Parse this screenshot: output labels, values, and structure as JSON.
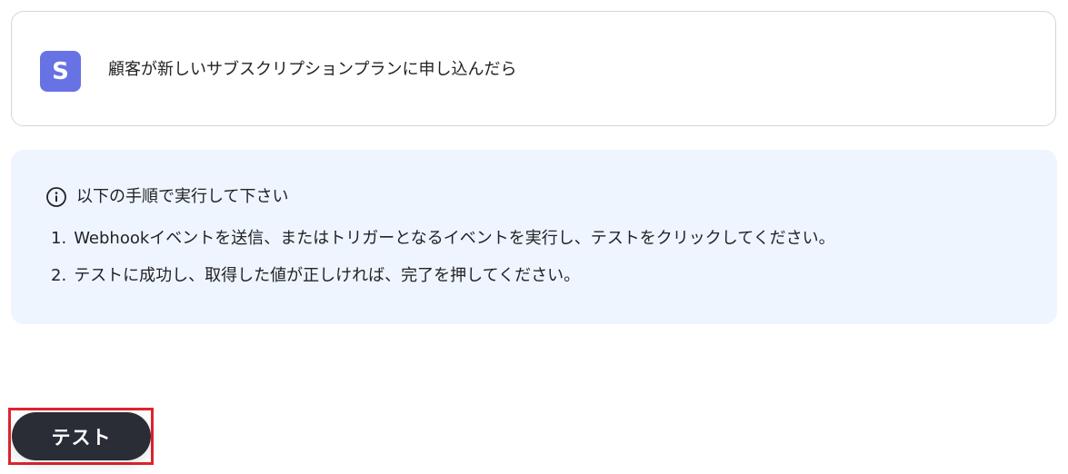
{
  "trigger": {
    "app_icon_letter": "S",
    "app_icon_color": "#6772e5",
    "app_icon_name": "stripe-app-icon",
    "title": "顧客が新しいサブスクリプションプランに申し込んだら"
  },
  "instructions": {
    "icon_name": "info-circle-icon",
    "heading": "以下の手順で実行して下さい",
    "steps": [
      {
        "num": "1.",
        "text": "Webhookイベントを送信、またはトリガーとなるイベントを実行し、テストをクリックしてください。"
      },
      {
        "num": "2.",
        "text": "テストに成功し、取得した値が正しければ、完了を押してください。"
      }
    ],
    "background": "#eef5fe"
  },
  "actions": {
    "test_label": "テスト",
    "test_button_color": "#2a2d36",
    "highlight_color": "#e0242f"
  }
}
